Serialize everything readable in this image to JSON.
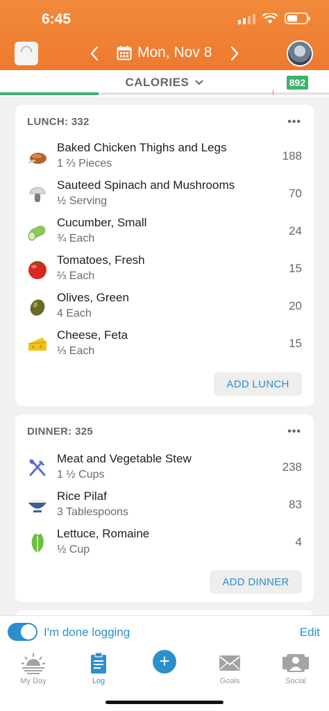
{
  "status": {
    "time": "6:45"
  },
  "header": {
    "date": "Mon, Nov 8"
  },
  "calories": {
    "label": "CALORIES",
    "remaining": "892",
    "progress_fraction": 0.3
  },
  "lunch": {
    "title": "LUNCH: 332",
    "items": [
      {
        "name": "Baked Chicken Thighs and Legs",
        "serving": "1 ⅔ Pieces",
        "cal": "188",
        "icon": "chicken-icon"
      },
      {
        "name": "Sauteed Spinach and Mushrooms",
        "serving": "½ Serving",
        "cal": "70",
        "icon": "mushroom-icon"
      },
      {
        "name": "Cucumber, Small",
        "serving": "¾ Each",
        "cal": "24",
        "icon": "cucumber-icon"
      },
      {
        "name": "Tomatoes, Fresh",
        "serving": "⅔ Each",
        "cal": "15",
        "icon": "tomato-icon"
      },
      {
        "name": "Olives, Green",
        "serving": "4 Each",
        "cal": "20",
        "icon": "olive-icon"
      },
      {
        "name": "Cheese, Feta",
        "serving": "⅓ Each",
        "cal": "15",
        "icon": "cheese-icon"
      }
    ],
    "add_label": "ADD LUNCH"
  },
  "dinner": {
    "title": "DINNER: 325",
    "items": [
      {
        "name": "Meat and Vegetable Stew",
        "serving": "1 ½ Cups",
        "cal": "238",
        "icon": "utensils-icon"
      },
      {
        "name": "Rice Pilaf",
        "serving": "3 Tablespoons",
        "cal": "83",
        "icon": "rice-bowl-icon"
      },
      {
        "name": "Lettuce, Romaine",
        "serving": "½ Cup",
        "cal": "4",
        "icon": "lettuce-icon"
      }
    ],
    "add_label": "ADD DINNER"
  },
  "done": {
    "label": "I'm done logging",
    "edit": "Edit",
    "toggle_on": true
  },
  "tabs": [
    {
      "label": "My Day",
      "icon": "sunrise-icon"
    },
    {
      "label": "Log",
      "icon": "clipboard-icon"
    },
    {
      "label": "",
      "icon": "plus-icon"
    },
    {
      "label": "Goals",
      "icon": "envelope-icon"
    },
    {
      "label": "Social",
      "icon": "people-icon"
    }
  ],
  "colors": {
    "header": "#ee7a2f",
    "accent": "#2b8fcd",
    "badge": "#3cb36a"
  }
}
